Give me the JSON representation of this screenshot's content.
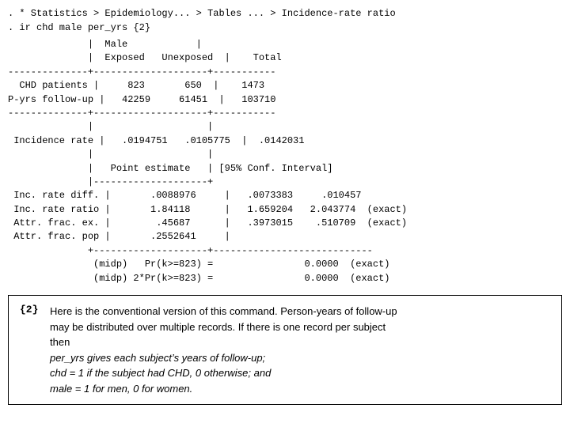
{
  "breadcrumb": ". * Statistics > Epidemiology... > Tables ... > Incidence-rate ratio",
  "command": ". ir chd male per_yrs                                                    {2}",
  "output": "              |  Male            |             \n              |  Exposed   Unexposed  |    Total    \n--------------+--------------------+-----------\n  CHD patients |     823       650  |    1473\nP-yrs follow-up |   42259     61451  |   103710\n--------------+--------------------+-----------\n              |                    |             \n Incidence rate |   .0194751   .0105775  |  .0142031\n              |                    |             \n              |   Point estimate   | [95% Conf. Interval]\n              |--------------------+\n Inc. rate diff. |       .0088976     |   .0073383     .010457\n Inc. rate ratio |       1.84118      |   1.659204   2.043774  (exact)\n Attr. frac. ex. |        .45687      |   .3973015    .510709  (exact)\n Attr. frac. pop |       .2552641     |\n              +--------------------+----------------------------\n               (midp)   Pr(k>=823) =                0.0000  (exact)\n               (midp) 2*Pr(k>=823) =                0.0000  (exact)",
  "footnote_number": "{2}",
  "footnote_lines": [
    "Here is the conventional version of this command.  Person-years of follow-up",
    "may be distributed over multiple records.  If there is one record per subject",
    "then",
    "per_yrs gives each subject’s years of follow-up;",
    "chd = 1 if the subject had CHD, 0 otherwise; and",
    "male = 1 for men, 0 for women."
  ]
}
